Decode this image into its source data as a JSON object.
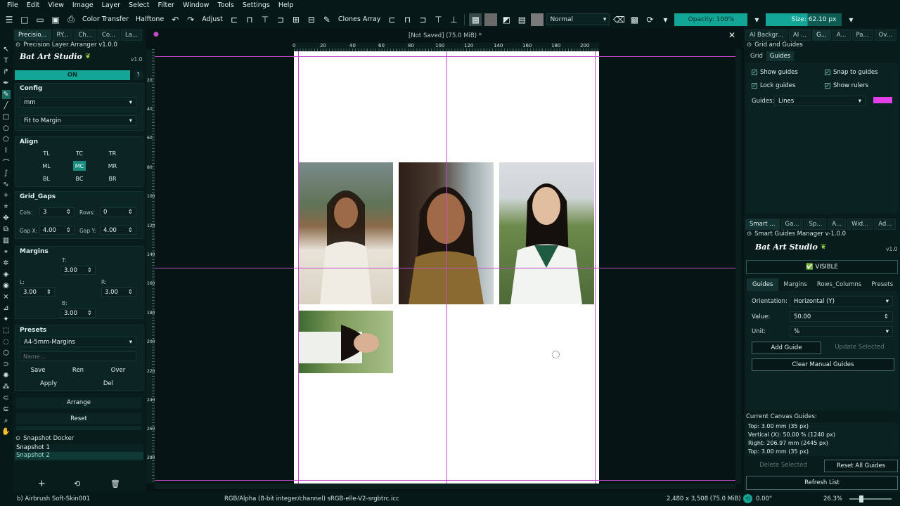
{
  "menu": [
    "File",
    "Edit",
    "View",
    "Image",
    "Layer",
    "Select",
    "Filter",
    "Window",
    "Tools",
    "Settings",
    "Help"
  ],
  "toolbar": {
    "color_transfer": "Color Transfer",
    "halftone": "Halftone",
    "adjust": "Adjust",
    "clones_array": "Clones Array",
    "blend_mode": "Normal",
    "opacity": "Opacity: 100%",
    "size": "Size: 62.10 px"
  },
  "left_tabs": [
    "Precisio...",
    "RY...",
    "Ch...",
    "Co...",
    "La..."
  ],
  "arranger": {
    "title": "Precision Layer Arranger v1.0.0",
    "logo": "Bat Art Studio",
    "version": "v1.0",
    "on_label": "ON",
    "help": "?",
    "config_h": "Config",
    "unit": "mm",
    "fit_mode": "Fit to Margin",
    "align_h": "Align",
    "align": [
      "TL",
      "TC",
      "TR",
      "ML",
      "MC",
      "MR",
      "BL",
      "BC",
      "BR"
    ],
    "grid_h": "Grid_Gaps",
    "cols_label": "Cols:",
    "cols": "3",
    "rows_label": "Rows:",
    "rows": "0",
    "gapx_label": "Gap X:",
    "gapx": "4.00",
    "gapy_label": "Gap Y:",
    "gapy": "4.00",
    "margins_h": "Margins",
    "t_label": "T:",
    "t": "3.00",
    "l_label": "L:",
    "l": "3.00",
    "r_label": "R:",
    "r": "3.00",
    "b_label": "B:",
    "b": "3.00",
    "presets_h": "Presets",
    "preset": "A4-5mm-Margins",
    "name_placeholder": "Name...",
    "save": "Save",
    "ren": "Ren",
    "over": "Over",
    "apply": "Apply",
    "del": "Del",
    "arrange": "Arrange",
    "reset": "Reset"
  },
  "snapshot": {
    "title": "Snapshot Docker",
    "items": [
      "Snapshot 1",
      "Snapshot 2"
    ]
  },
  "canvas": {
    "title": "[Not Saved]  (75.0 MiB) *",
    "ruler_top": [
      "0",
      "20",
      "40",
      "60",
      "80",
      "100",
      "120",
      "140",
      "160",
      "180",
      "200"
    ],
    "ruler_left": [
      "20",
      "40",
      "60",
      "80",
      "100",
      "120",
      "140",
      "160",
      "180",
      "200",
      "220",
      "240",
      "260",
      "280"
    ]
  },
  "right_top_tabs": [
    "AI Backgr...",
    "AI ...",
    "G...",
    "A...",
    "Pa...",
    "Ov..."
  ],
  "grid_guides": {
    "title": "Grid and Guides",
    "tabs": [
      "Grid",
      "Guides"
    ],
    "show_guides": "Show guides",
    "snap_to_guides": "Snap to guides",
    "lock_guides": "Lock guides",
    "show_rulers": "Show rulers",
    "guides_label": "Guides:",
    "guides_type": "Lines",
    "guide_color": "#e040e6"
  },
  "right_mid_tabs": [
    "Smart ...",
    "Ga...",
    "Sp...",
    "A...",
    "Wid...",
    "Ad..."
  ],
  "smart_guides": {
    "title": "Smart Guides Manager v-1.0.0",
    "logo": "Bat Art Studio",
    "version": "v1.0",
    "visible": "✅ VISIBLE",
    "tabs": [
      "Guides",
      "Margins",
      "Rows_Columns",
      "Presets"
    ],
    "orientation_label": "Orientation:",
    "orientation": "Horizontal (Y)",
    "value_label": "Value:",
    "value": "50.00",
    "unit_label": "Unit:",
    "unit": "%",
    "add_guide": "Add Guide",
    "update_selected": "Update Selected",
    "clear_manual": "Clear Manual Guides",
    "current_label": "Current Canvas Guides:",
    "current": [
      "Top: 3.00 mm (35 px)",
      "Vertical (X): 50.00 % (1240 px)",
      "Right: 206.97 mm (2445 px)",
      "Top: 3.00 mm (35 px)"
    ],
    "delete_selected": "Delete Selected",
    "reset_all": "Reset All Guides",
    "refresh": "Refresh List"
  },
  "status": {
    "brush": "b) Airbrush Soft-Skin001",
    "color": "RGB/Alpha (8-bit integer/channel)  sRGB-elle-V2-srgbtrc.icc",
    "dims": "2,480 x 3,508 (75.0 MiB)",
    "angle": "0.00°",
    "zoom": "26.3%"
  },
  "colors": {
    "accent": "#13a595",
    "guide": "#c24cc8",
    "bg": "#061616"
  }
}
